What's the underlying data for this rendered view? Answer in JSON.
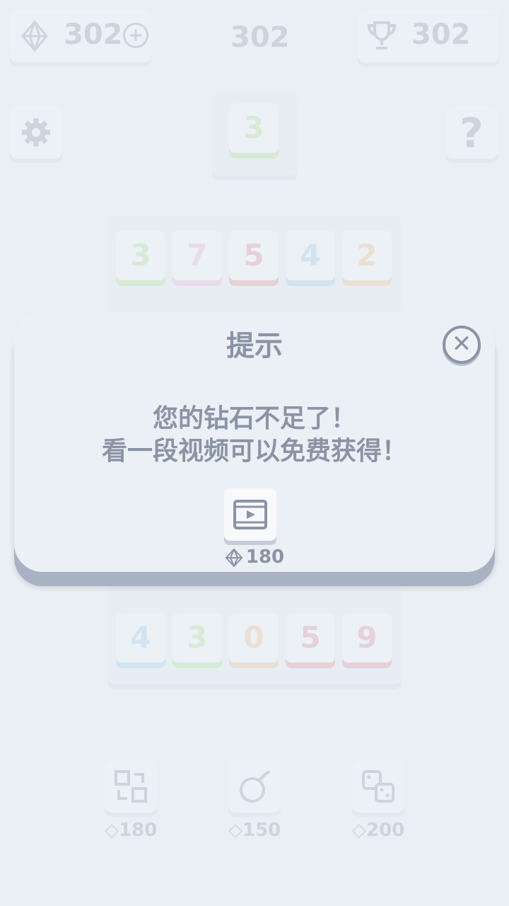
{
  "top_bar": {
    "gems": "302",
    "center_score": "302",
    "best": "302"
  },
  "next_tile": "3",
  "board_top_row": [
    "3",
    "7",
    "5",
    "4",
    "2"
  ],
  "board_bottom_row": [
    "4",
    "3",
    "0",
    "5",
    "9"
  ],
  "powerups": [
    {
      "name": "swap",
      "cost": "180"
    },
    {
      "name": "bomb",
      "cost": "150"
    },
    {
      "name": "dice",
      "cost": "200"
    }
  ],
  "dialog": {
    "title": "提示",
    "line1": "您的钻石不足了！",
    "line2": "看一段视频可以免费获得！",
    "reward": "180"
  },
  "colors": {
    "green": "#b8e39a",
    "pink": "#e8b9d9",
    "red": "#e29aa5",
    "blue": "#a9cdeb",
    "orange": "#edc49a"
  }
}
